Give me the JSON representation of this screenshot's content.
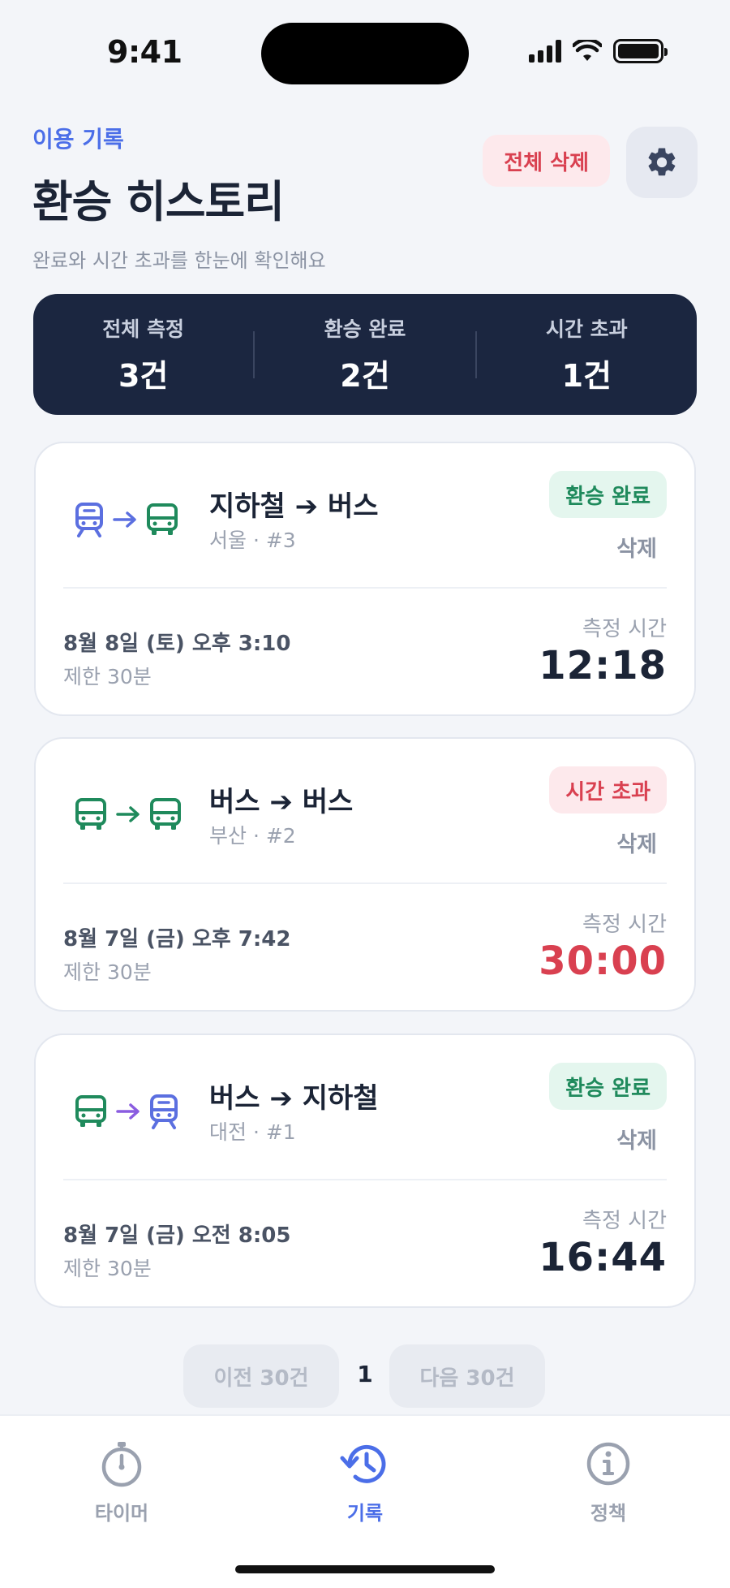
{
  "status_bar": {
    "time": "9:41"
  },
  "header": {
    "eyebrow": "이용 기록",
    "title": "환승 히스토리",
    "subtitle": "완료와 시간 초과를 한눈에 확인해요",
    "delete_all_label": "전체 삭제",
    "settings_icon": "gear-icon"
  },
  "summary": [
    {
      "label": "전체 측정",
      "value": "3건"
    },
    {
      "label": "환승 완료",
      "value": "2건"
    },
    {
      "label": "시간 초과",
      "value": "1건"
    }
  ],
  "records": [
    {
      "from_icon": "train-icon",
      "to_icon": "bus-icon",
      "route": "지하철 ➔ 버스",
      "meta": "서울 · #3",
      "status": "환승 완료",
      "status_type": "ok",
      "delete_label": "삭제",
      "date": "8월 8일 (토) 오후 3:10",
      "limit": "제한 30분",
      "measure_label": "측정 시간",
      "measure": "12:18"
    },
    {
      "from_icon": "bus-icon",
      "to_icon": "bus-icon",
      "route": "버스 ➔ 버스",
      "meta": "부산 · #2",
      "status": "시간 초과",
      "status_type": "over",
      "delete_label": "삭제",
      "date": "8월 7일 (금) 오후 7:42",
      "limit": "제한 30분",
      "measure_label": "측정 시간",
      "measure": "30:00"
    },
    {
      "from_icon": "bus-icon",
      "to_icon": "train-icon",
      "route": "버스 ➔ 지하철",
      "meta": "대전 · #1",
      "status": "환승 완료",
      "status_type": "ok",
      "delete_label": "삭제",
      "date": "8월 7일 (금) 오전 8:05",
      "limit": "제한 30분",
      "measure_label": "측정 시간",
      "measure": "16:44"
    }
  ],
  "pagination": {
    "prev_label": "이전 30건",
    "page": "1",
    "next_label": "다음 30건"
  },
  "tabbar": {
    "tabs": [
      {
        "label": "타이머",
        "icon": "stopwatch-icon"
      },
      {
        "label": "기록",
        "icon": "history-icon",
        "active": true
      },
      {
        "label": "정책",
        "icon": "info-icon"
      }
    ]
  },
  "colors": {
    "accent": "#4b6ee8",
    "train": "#5b6fe0",
    "bus": "#1f8a5c",
    "danger": "#d94050",
    "navy": "#1b2640",
    "arrow_purple": "#8a5ce0"
  }
}
